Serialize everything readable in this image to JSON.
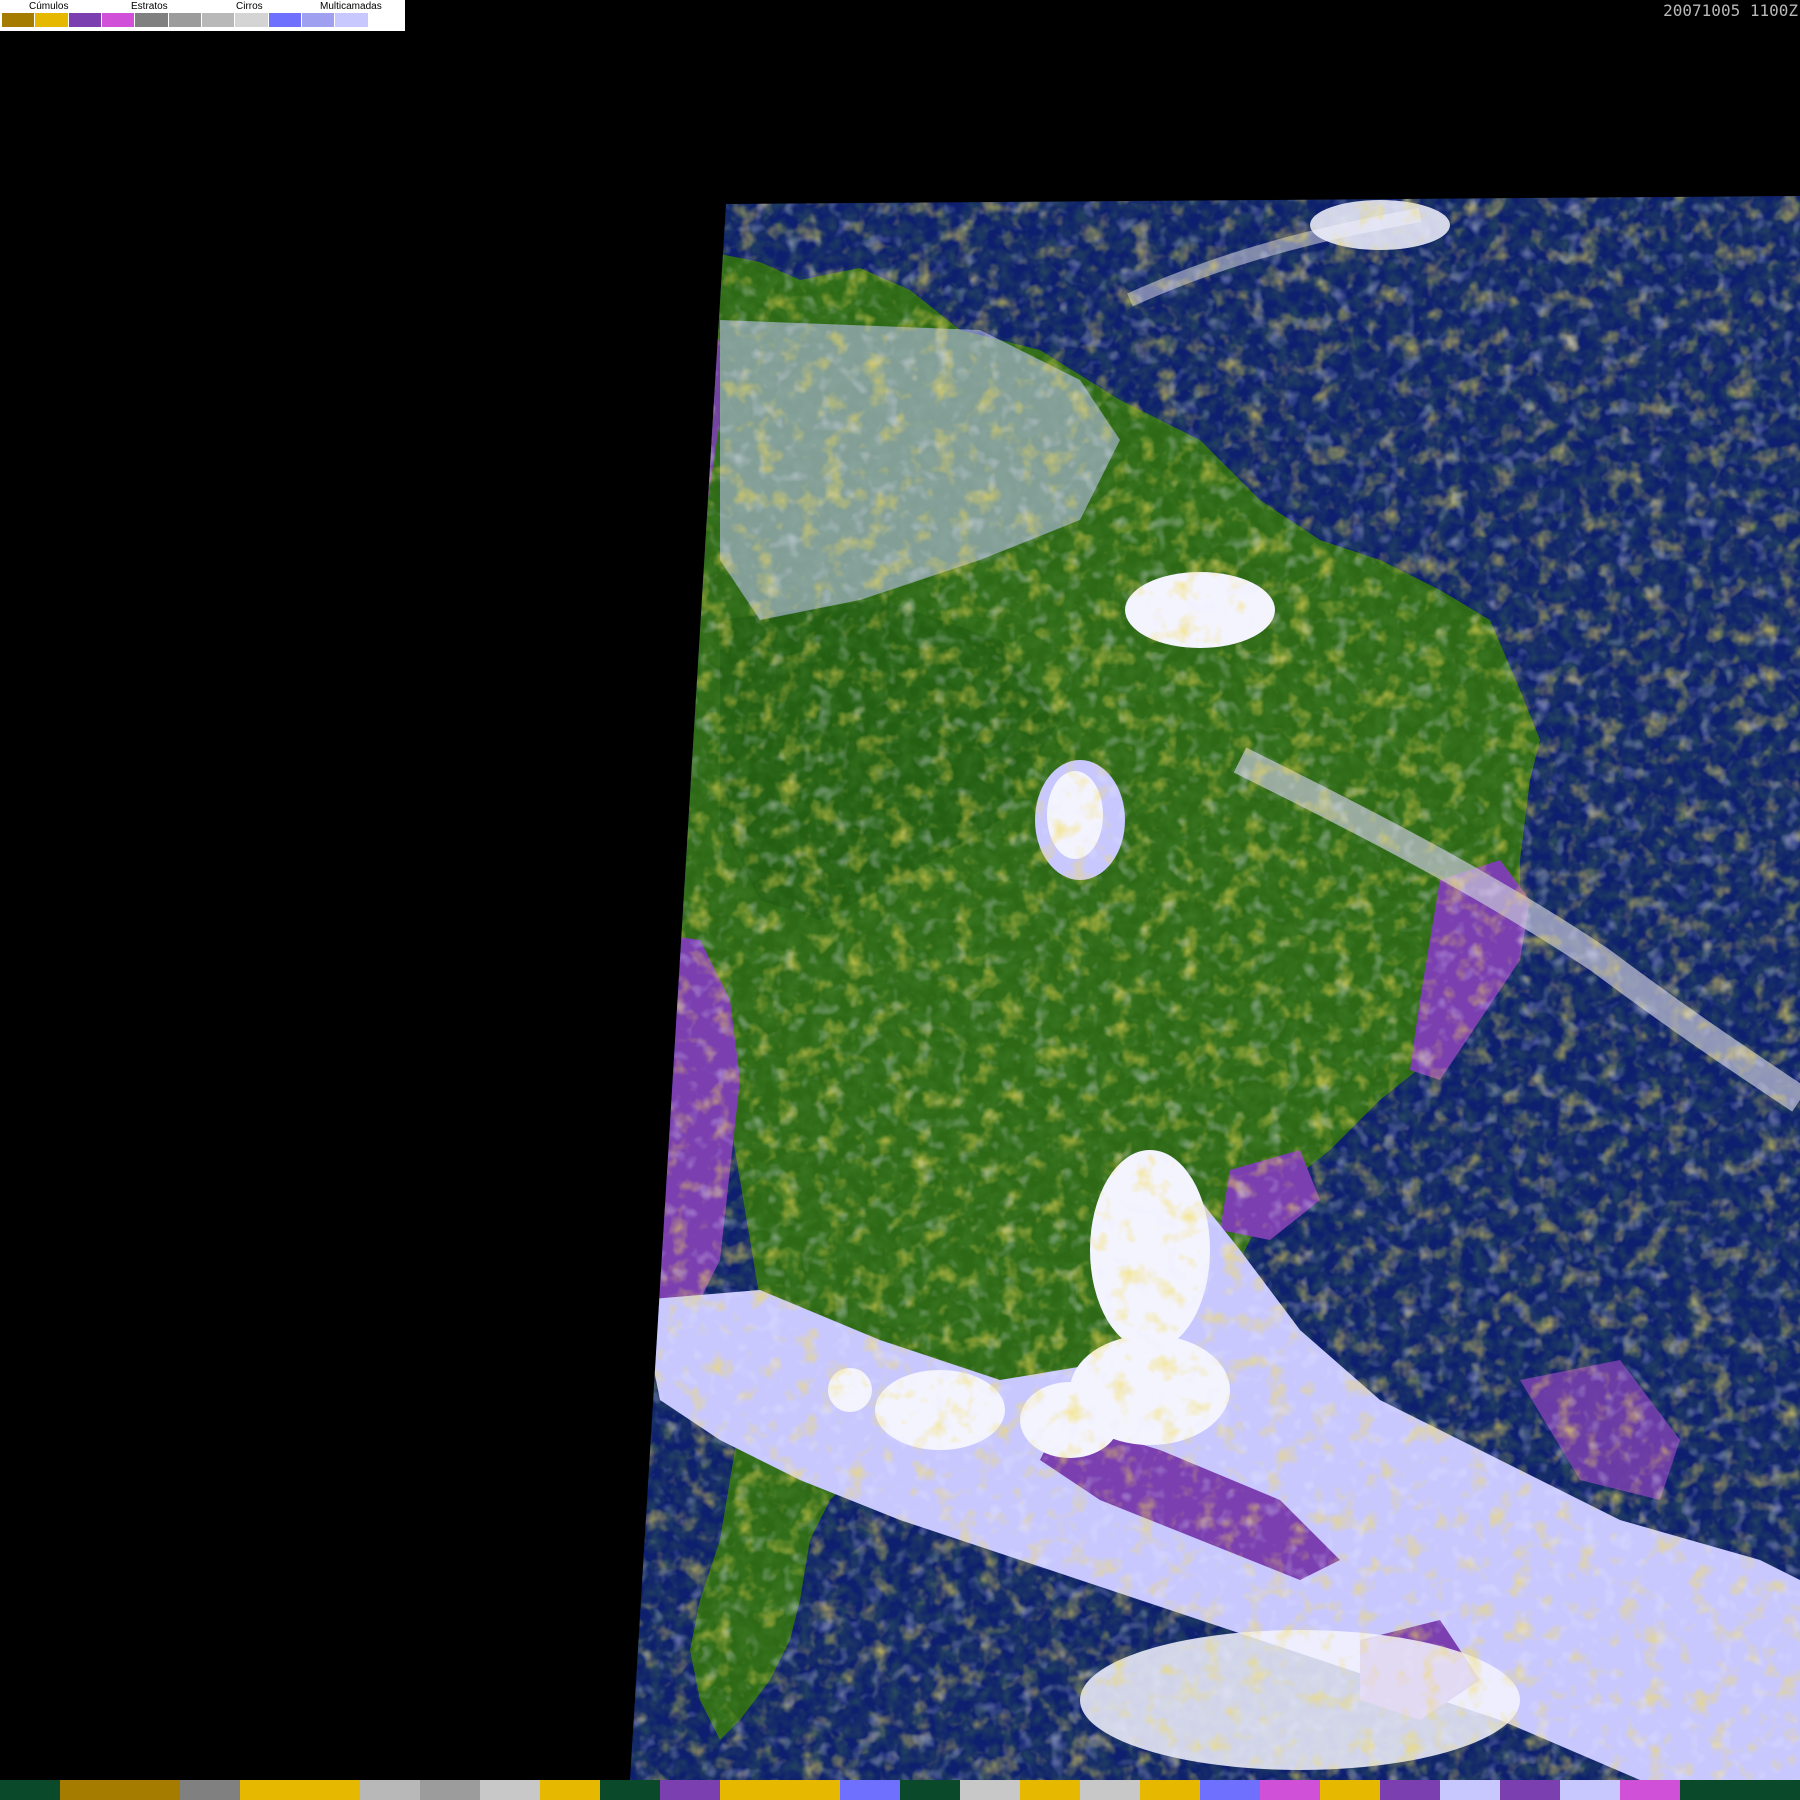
{
  "timestamp": "20071005 1100Z",
  "legend": {
    "labels": [
      "Cúmulos",
      "Estratos",
      "Cirros",
      "Multicamadas"
    ],
    "swatches": [
      "#a67c00",
      "#e6b800",
      "#7b3fb0",
      "#d050d8",
      "#808080",
      "#9c9c9c",
      "#b8b8b8",
      "#d4d4d4",
      "#7070ff",
      "#a0a0f0",
      "#c8c8ff",
      "#ffffff"
    ]
  },
  "colors": {
    "background": "#000000",
    "ocean": "#0d1f6e",
    "land": "#2e6a16",
    "land_dark": "#1e5610",
    "cumulus": "#e6b800",
    "cumulus_dark": "#a67c00",
    "stratus": "#7b3fb0",
    "stratus_light": "#d050d8",
    "cirrus": "#b8b8b8",
    "multilayer": "#c8c8ff",
    "multilayer_blue": "#7070ff",
    "deep_cloud": "#f4f4ff"
  },
  "bottom_bar": {
    "swatches": [
      "#0a4a2a",
      "#a67c00",
      "#a67c00",
      "#808080",
      "#e6b800",
      "#e6b800",
      "#b8b8b8",
      "#9c9c9c",
      "#c8c8c8",
      "#e6b800",
      "#0a4a2a",
      "#7b3fb0",
      "#e6b800",
      "#e6b800",
      "#7070ff",
      "#0a4a2a",
      "#c8c8c8",
      "#e6b800",
      "#c8c8c8",
      "#e6b800",
      "#7070ff",
      "#d050d8",
      "#e6b800",
      "#7b3fb0",
      "#c8c8ff",
      "#7b3fb0",
      "#c8c8ff",
      "#d050d8",
      "#0a4a2a",
      "#0a4a2a"
    ]
  }
}
